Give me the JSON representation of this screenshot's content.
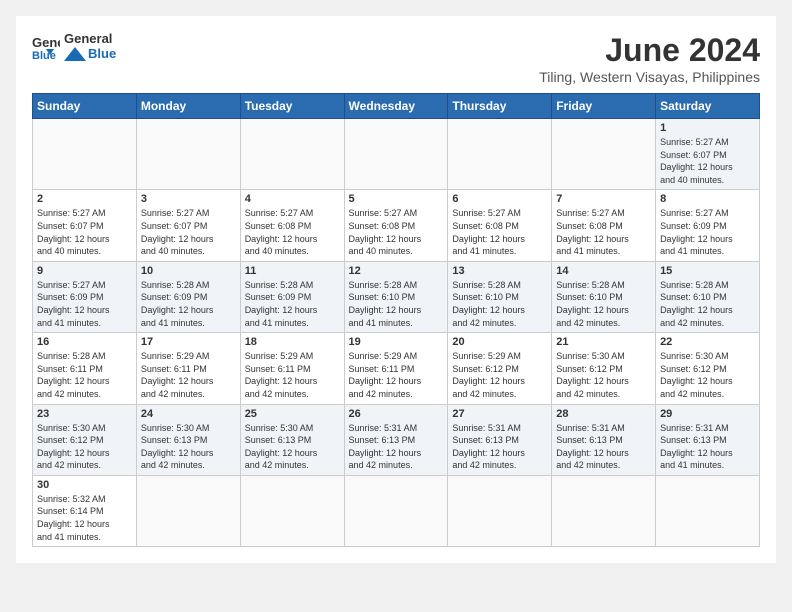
{
  "header": {
    "logo_general": "General",
    "logo_blue": "Blue",
    "title": "June 2024",
    "subtitle": "Tiling, Western Visayas, Philippines"
  },
  "weekdays": [
    "Sunday",
    "Monday",
    "Tuesday",
    "Wednesday",
    "Thursday",
    "Friday",
    "Saturday"
  ],
  "weeks": [
    [
      {
        "day": "",
        "info": ""
      },
      {
        "day": "",
        "info": ""
      },
      {
        "day": "",
        "info": ""
      },
      {
        "day": "",
        "info": ""
      },
      {
        "day": "",
        "info": ""
      },
      {
        "day": "",
        "info": ""
      },
      {
        "day": "1",
        "info": "Sunrise: 5:27 AM\nSunset: 6:07 PM\nDaylight: 12 hours\nand 40 minutes."
      }
    ],
    [
      {
        "day": "2",
        "info": "Sunrise: 5:27 AM\nSunset: 6:07 PM\nDaylight: 12 hours\nand 40 minutes."
      },
      {
        "day": "3",
        "info": "Sunrise: 5:27 AM\nSunset: 6:07 PM\nDaylight: 12 hours\nand 40 minutes."
      },
      {
        "day": "4",
        "info": "Sunrise: 5:27 AM\nSunset: 6:08 PM\nDaylight: 12 hours\nand 40 minutes."
      },
      {
        "day": "5",
        "info": "Sunrise: 5:27 AM\nSunset: 6:08 PM\nDaylight: 12 hours\nand 40 minutes."
      },
      {
        "day": "6",
        "info": "Sunrise: 5:27 AM\nSunset: 6:08 PM\nDaylight: 12 hours\nand 41 minutes."
      },
      {
        "day": "7",
        "info": "Sunrise: 5:27 AM\nSunset: 6:08 PM\nDaylight: 12 hours\nand 41 minutes."
      },
      {
        "day": "8",
        "info": "Sunrise: 5:27 AM\nSunset: 6:09 PM\nDaylight: 12 hours\nand 41 minutes."
      }
    ],
    [
      {
        "day": "9",
        "info": "Sunrise: 5:27 AM\nSunset: 6:09 PM\nDaylight: 12 hours\nand 41 minutes."
      },
      {
        "day": "10",
        "info": "Sunrise: 5:28 AM\nSunset: 6:09 PM\nDaylight: 12 hours\nand 41 minutes."
      },
      {
        "day": "11",
        "info": "Sunrise: 5:28 AM\nSunset: 6:09 PM\nDaylight: 12 hours\nand 41 minutes."
      },
      {
        "day": "12",
        "info": "Sunrise: 5:28 AM\nSunset: 6:10 PM\nDaylight: 12 hours\nand 41 minutes."
      },
      {
        "day": "13",
        "info": "Sunrise: 5:28 AM\nSunset: 6:10 PM\nDaylight: 12 hours\nand 42 minutes."
      },
      {
        "day": "14",
        "info": "Sunrise: 5:28 AM\nSunset: 6:10 PM\nDaylight: 12 hours\nand 42 minutes."
      },
      {
        "day": "15",
        "info": "Sunrise: 5:28 AM\nSunset: 6:10 PM\nDaylight: 12 hours\nand 42 minutes."
      }
    ],
    [
      {
        "day": "16",
        "info": "Sunrise: 5:28 AM\nSunset: 6:11 PM\nDaylight: 12 hours\nand 42 minutes."
      },
      {
        "day": "17",
        "info": "Sunrise: 5:29 AM\nSunset: 6:11 PM\nDaylight: 12 hours\nand 42 minutes."
      },
      {
        "day": "18",
        "info": "Sunrise: 5:29 AM\nSunset: 6:11 PM\nDaylight: 12 hours\nand 42 minutes."
      },
      {
        "day": "19",
        "info": "Sunrise: 5:29 AM\nSunset: 6:11 PM\nDaylight: 12 hours\nand 42 minutes."
      },
      {
        "day": "20",
        "info": "Sunrise: 5:29 AM\nSunset: 6:12 PM\nDaylight: 12 hours\nand 42 minutes."
      },
      {
        "day": "21",
        "info": "Sunrise: 5:30 AM\nSunset: 6:12 PM\nDaylight: 12 hours\nand 42 minutes."
      },
      {
        "day": "22",
        "info": "Sunrise: 5:30 AM\nSunset: 6:12 PM\nDaylight: 12 hours\nand 42 minutes."
      }
    ],
    [
      {
        "day": "23",
        "info": "Sunrise: 5:30 AM\nSunset: 6:12 PM\nDaylight: 12 hours\nand 42 minutes."
      },
      {
        "day": "24",
        "info": "Sunrise: 5:30 AM\nSunset: 6:13 PM\nDaylight: 12 hours\nand 42 minutes."
      },
      {
        "day": "25",
        "info": "Sunrise: 5:30 AM\nSunset: 6:13 PM\nDaylight: 12 hours\nand 42 minutes."
      },
      {
        "day": "26",
        "info": "Sunrise: 5:31 AM\nSunset: 6:13 PM\nDaylight: 12 hours\nand 42 minutes."
      },
      {
        "day": "27",
        "info": "Sunrise: 5:31 AM\nSunset: 6:13 PM\nDaylight: 12 hours\nand 42 minutes."
      },
      {
        "day": "28",
        "info": "Sunrise: 5:31 AM\nSunset: 6:13 PM\nDaylight: 12 hours\nand 42 minutes."
      },
      {
        "day": "29",
        "info": "Sunrise: 5:31 AM\nSunset: 6:13 PM\nDaylight: 12 hours\nand 41 minutes."
      }
    ],
    [
      {
        "day": "30",
        "info": "Sunrise: 5:32 AM\nSunset: 6:14 PM\nDaylight: 12 hours\nand 41 minutes."
      },
      {
        "day": "",
        "info": ""
      },
      {
        "day": "",
        "info": ""
      },
      {
        "day": "",
        "info": ""
      },
      {
        "day": "",
        "info": ""
      },
      {
        "day": "",
        "info": ""
      },
      {
        "day": "",
        "info": ""
      }
    ]
  ]
}
